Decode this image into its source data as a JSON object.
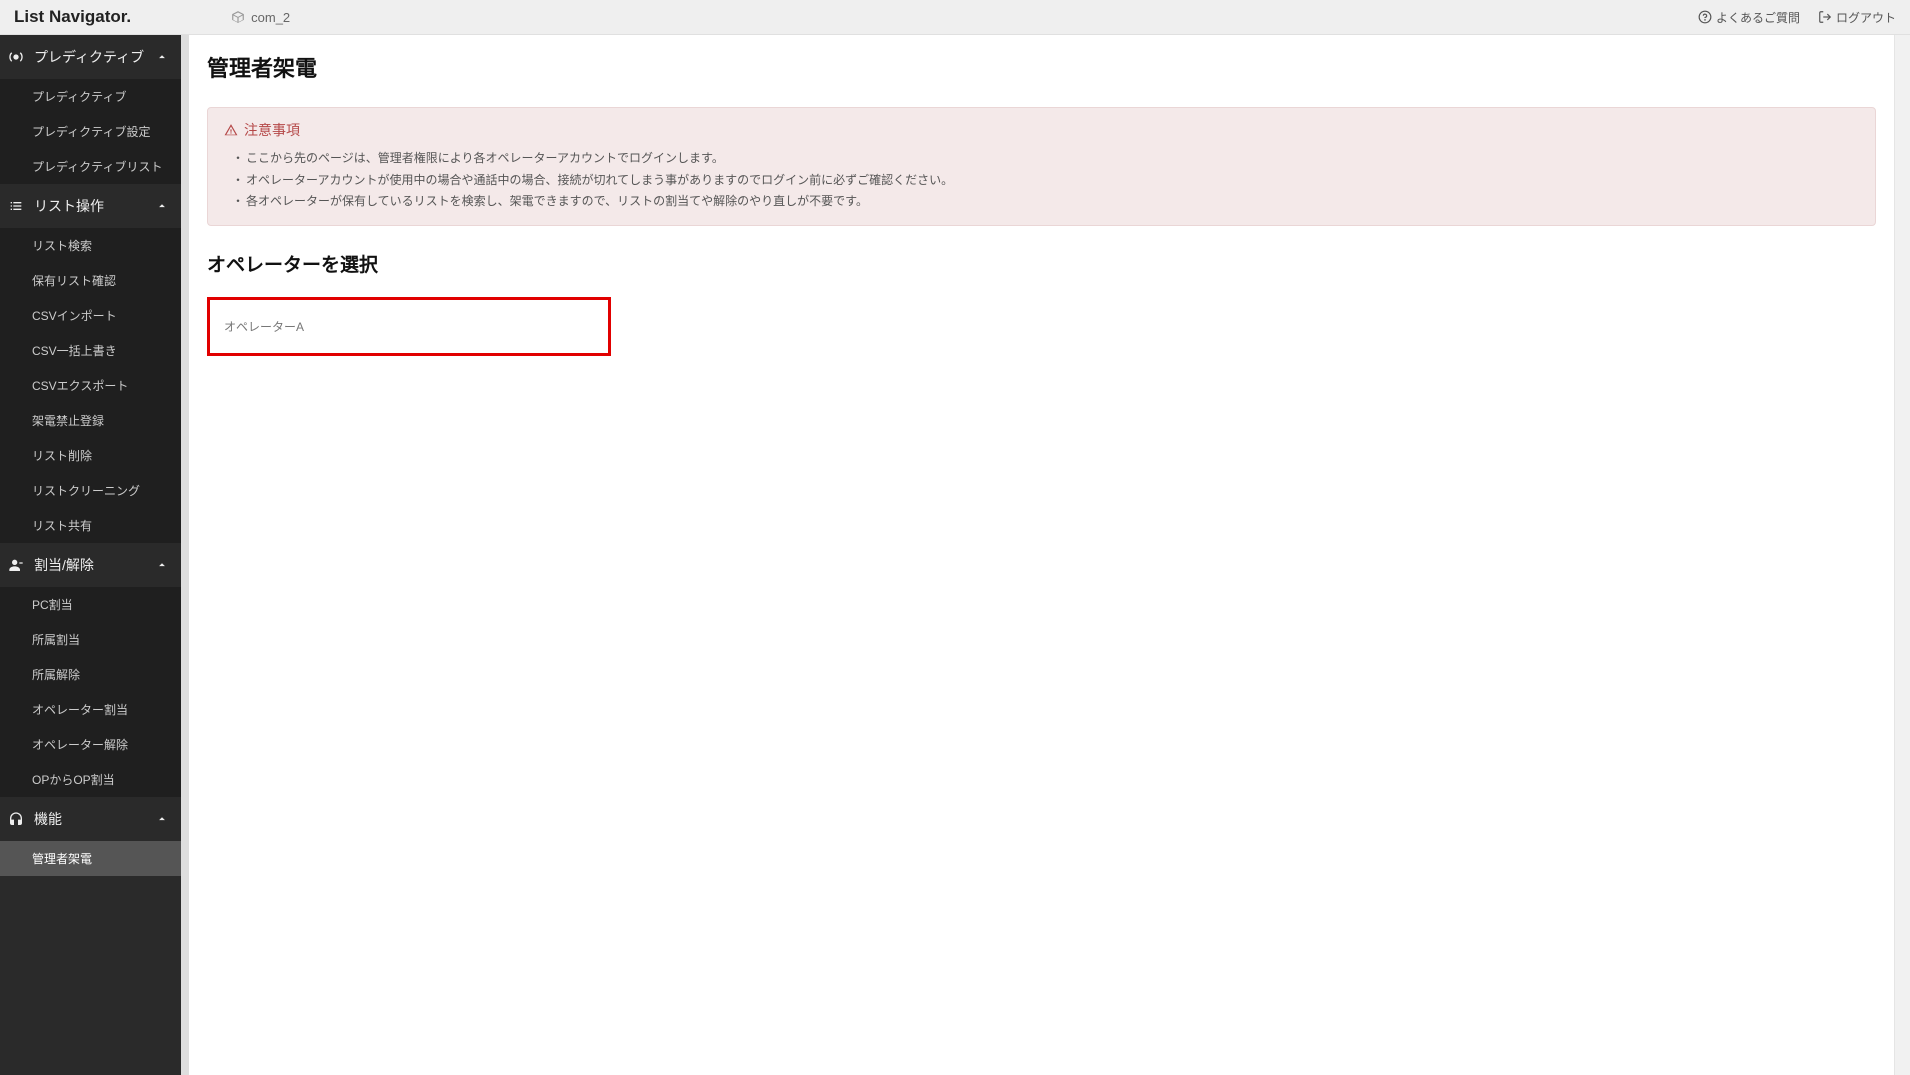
{
  "header": {
    "logo": "List Navigator.",
    "company": "com_2",
    "faq_label": "よくあるご質問",
    "logout_label": "ログアウト"
  },
  "sidebar": {
    "groups": [
      {
        "label": "プレディクティブ",
        "items": [
          {
            "label": "プレディクティブ"
          },
          {
            "label": "プレディクティブ設定"
          },
          {
            "label": "プレディクティブリスト"
          }
        ]
      },
      {
        "label": "リスト操作",
        "items": [
          {
            "label": "リスト検索"
          },
          {
            "label": "保有リスト確認"
          },
          {
            "label": "CSVインポート"
          },
          {
            "label": "CSV一括上書き"
          },
          {
            "label": "CSVエクスポート"
          },
          {
            "label": "架電禁止登録"
          },
          {
            "label": "リスト削除"
          },
          {
            "label": "リストクリーニング"
          },
          {
            "label": "リスト共有"
          }
        ]
      },
      {
        "label": "割当/解除",
        "items": [
          {
            "label": "PC割当"
          },
          {
            "label": "所属割当"
          },
          {
            "label": "所属解除"
          },
          {
            "label": "オペレーター割当"
          },
          {
            "label": "オペレーター解除"
          },
          {
            "label": "OPからOP割当"
          }
        ]
      },
      {
        "label": "機能",
        "items": [
          {
            "label": "管理者架電",
            "active": true
          }
        ]
      }
    ]
  },
  "main": {
    "page_title": "管理者架電",
    "alert": {
      "title": "注意事項",
      "items": [
        "ここから先のページは、管理者権限により各オペレーターアカウントでログインします。",
        "オペレーターアカウントが使用中の場合や通話中の場合、接続が切れてしまう事がありますのでログイン前に必ずご確認ください。",
        "各オペレーターが保有しているリストを検索し、架電できますので、リストの割当てや解除のやり直しが不要です。"
      ]
    },
    "section_title": "オペレーターを選択",
    "operator": {
      "label": "オペレーターA"
    }
  }
}
